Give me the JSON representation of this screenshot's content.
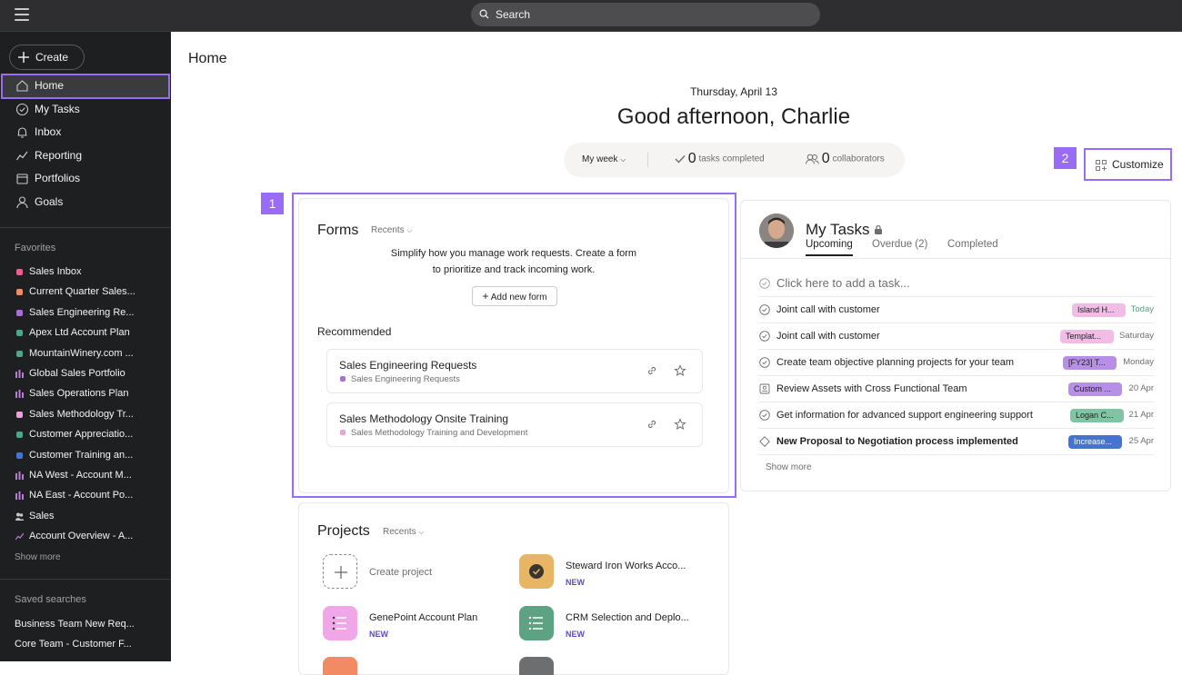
{
  "topbar": {
    "search_placeholder": "Search"
  },
  "sidebar": {
    "create_label": "Create",
    "nav": [
      {
        "label": "Home",
        "icon": "home-icon",
        "active": true
      },
      {
        "label": "My Tasks",
        "icon": "check-circle-icon"
      },
      {
        "label": "Inbox",
        "icon": "bell-icon"
      },
      {
        "label": "Reporting",
        "icon": "trend-line-icon"
      },
      {
        "label": "Portfolios",
        "icon": "folder-icon"
      },
      {
        "label": "Goals",
        "icon": "person-goal-icon"
      }
    ],
    "favorites_title": "Favorites",
    "favorites": [
      {
        "label": "Sales Inbox",
        "kind": "dot",
        "color": "#e8608b"
      },
      {
        "label": "Current Quarter Sales...",
        "kind": "dot",
        "color": "#f28a64"
      },
      {
        "label": "Sales Engineering Re...",
        "kind": "dot",
        "color": "#a66fd9"
      },
      {
        "label": "Apex Ltd Account Plan",
        "kind": "dot",
        "color": "#4ea687"
      },
      {
        "label": "MountainWinery.com ...",
        "kind": "dot",
        "color": "#4ea687"
      },
      {
        "label": "Global Sales Portfolio",
        "kind": "bars",
        "color": "#b87bd6"
      },
      {
        "label": "Sales Operations Plan",
        "kind": "bars",
        "color": "#b87bd6"
      },
      {
        "label": "Sales Methodology Tr...",
        "kind": "dot",
        "color": "#e8a3d9"
      },
      {
        "label": "Customer Appreciatio...",
        "kind": "dot",
        "color": "#4ea687"
      },
      {
        "label": "Customer Training an...",
        "kind": "dot",
        "color": "#4573d2"
      },
      {
        "label": "NA West - Account M...",
        "kind": "bars",
        "color": "#b87bd6"
      },
      {
        "label": "NA East - Account Po...",
        "kind": "bars",
        "color": "#b87bd6"
      },
      {
        "label": "Sales",
        "kind": "people",
        "color": "#c9c9cb"
      },
      {
        "label": "Account Overview - A...",
        "kind": "trend",
        "color": "#b87bd6"
      }
    ],
    "show_more": "Show more",
    "saved_title": "Saved searches",
    "saved": [
      "Business Team New Req...",
      "Core Team - Customer F..."
    ]
  },
  "main": {
    "page_title": "Home",
    "date": "Thursday, April 13",
    "greeting": "Good afternoon, Charlie",
    "stats": {
      "period": "My week",
      "tasks_completed_num": "0",
      "tasks_completed_label": "tasks completed",
      "collaborators_num": "0",
      "collaborators_label": "collaborators"
    },
    "customize_label": "Customize",
    "callouts": {
      "one": "1",
      "two": "2"
    }
  },
  "forms": {
    "title": "Forms",
    "recents": "Recents",
    "desc_line1": "Simplify how you manage work requests. Create a form",
    "desc_line2": "to prioritize and track incoming work.",
    "add_button": "Add new form",
    "recommended_label": "Recommended",
    "items": [
      {
        "title": "Sales Engineering Requests",
        "sub": "Sales Engineering Requests",
        "color": "#a66fd9"
      },
      {
        "title": "Sales Methodology Onsite Training",
        "sub": "Sales Methodology Training and Development",
        "color": "#e8a3d9"
      }
    ]
  },
  "my_tasks": {
    "title": "My Tasks",
    "tabs": [
      "Upcoming",
      "Overdue (2)",
      "Completed"
    ],
    "add_task": "Click here to add a task...",
    "tasks": [
      {
        "name": "Joint call with customer",
        "tag": "Island H...",
        "tag_color": "#f1bde6",
        "due": "Today",
        "due_color": "#58a182",
        "icon": "check"
      },
      {
        "name": "Joint call with customer",
        "tag": "Templat...",
        "tag_color": "#f1bde6",
        "due": "Saturday",
        "due_color": "#6d6e6f",
        "icon": "check"
      },
      {
        "name": "Create team objective planning projects for your team",
        "tag": "[FY23] T...",
        "tag_color": "#b88fe8",
        "due": "Monday",
        "due_color": "#6d6e6f",
        "icon": "check"
      },
      {
        "name": "Review Assets with Cross Functional Team",
        "tag": "Custom ...",
        "tag_color": "#b88fe8",
        "due": "20 Apr",
        "due_color": "#6d6e6f",
        "icon": "approval"
      },
      {
        "name": "Get information for advanced support engineering support",
        "tag": "Logan C...",
        "tag_color": "#7fc4a3",
        "due": "21 Apr",
        "due_color": "#6d6e6f",
        "icon": "check"
      },
      {
        "name": "New Proposal to Negotiation process implemented",
        "tag": "Increase...",
        "tag_color": "#4573d2",
        "due": "25 Apr",
        "due_color": "#6d6e6f",
        "icon": "milestone",
        "bold": true
      }
    ],
    "show_more": "Show more"
  },
  "projects": {
    "title": "Projects",
    "recents": "Recents",
    "items": [
      {
        "name": "Create project",
        "new": "",
        "color": "#ffffff",
        "icon": "plus"
      },
      {
        "name": "Steward Iron Works Acco...",
        "new": "NEW",
        "color": "#e8b565",
        "icon": "check"
      },
      {
        "name": "GenePoint Account Plan",
        "new": "NEW",
        "color": "#f1a6e8",
        "icon": "list"
      },
      {
        "name": "CRM Selection and Deplo...",
        "new": "NEW",
        "color": "#5da283",
        "icon": "list"
      }
    ]
  }
}
